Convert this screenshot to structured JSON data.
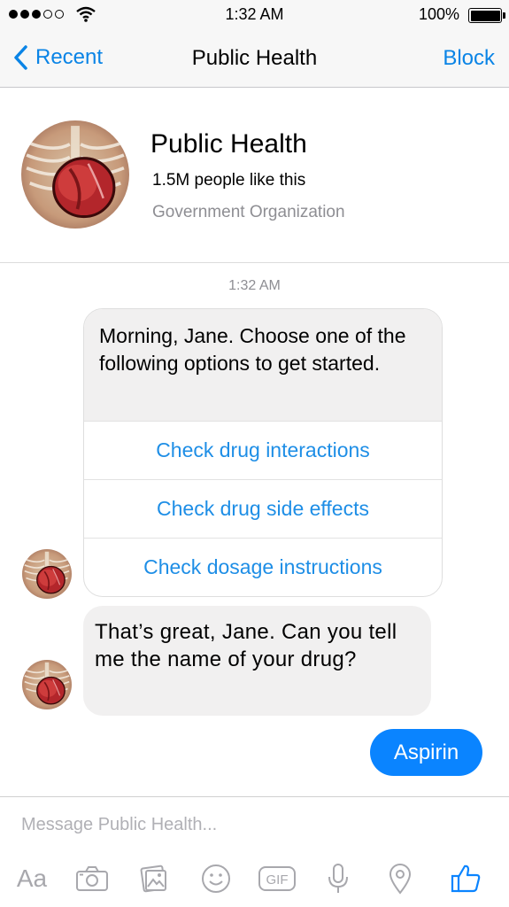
{
  "status_bar": {
    "time": "1:32 AM",
    "battery": "100%"
  },
  "nav": {
    "back_label": "Recent",
    "title": "Public Health",
    "action_label": "Block"
  },
  "profile": {
    "name": "Public Health",
    "likes": "1.5M people like this",
    "category": "Government Organization"
  },
  "conversation": {
    "timestamp": "1:32 AM",
    "bot_card": {
      "text": "Morning, Jane. Choose one of the following options to get started.",
      "options": [
        {
          "label": "Check drug interactions"
        },
        {
          "label": "Check drug side effects"
        },
        {
          "label": "Check dosage instructions"
        }
      ]
    },
    "bot_message": "That’s great, Jane. Can you tell me the name of your drug?",
    "user_message": "Aspirin"
  },
  "composer": {
    "placeholder": "Message Public Health...",
    "tools": {
      "text": "Aa",
      "gif": "GIF"
    }
  },
  "colors": {
    "accent": "#0a84ff",
    "link": "#1e8ee6",
    "bubble_gray": "#f1f0f0",
    "icon_gray": "#a8a8ad"
  }
}
